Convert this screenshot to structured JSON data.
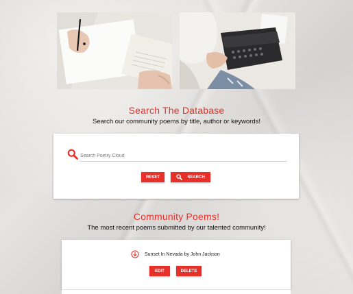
{
  "search_section": {
    "title": "Search The Database",
    "subtitle": "Search our community poems by title, author or keywords!",
    "placeholder": "Search Poetry Cloud",
    "reset_label": "RESET",
    "search_label": "SEARCH"
  },
  "community_section": {
    "title": "Community Poems!",
    "subtitle": "The most recent poems submitted by our talented community!",
    "poems": [
      {
        "title": "Sunset In Nevada by John Jackson",
        "edit_label": "EDIT",
        "delete_label": "DELETE"
      }
    ]
  },
  "theme": {
    "accent": "#e8302a",
    "card": "#ffffff",
    "paper": "#dcdad7"
  },
  "icons": {
    "search": "search-icon",
    "download": "download-circle-icon"
  }
}
